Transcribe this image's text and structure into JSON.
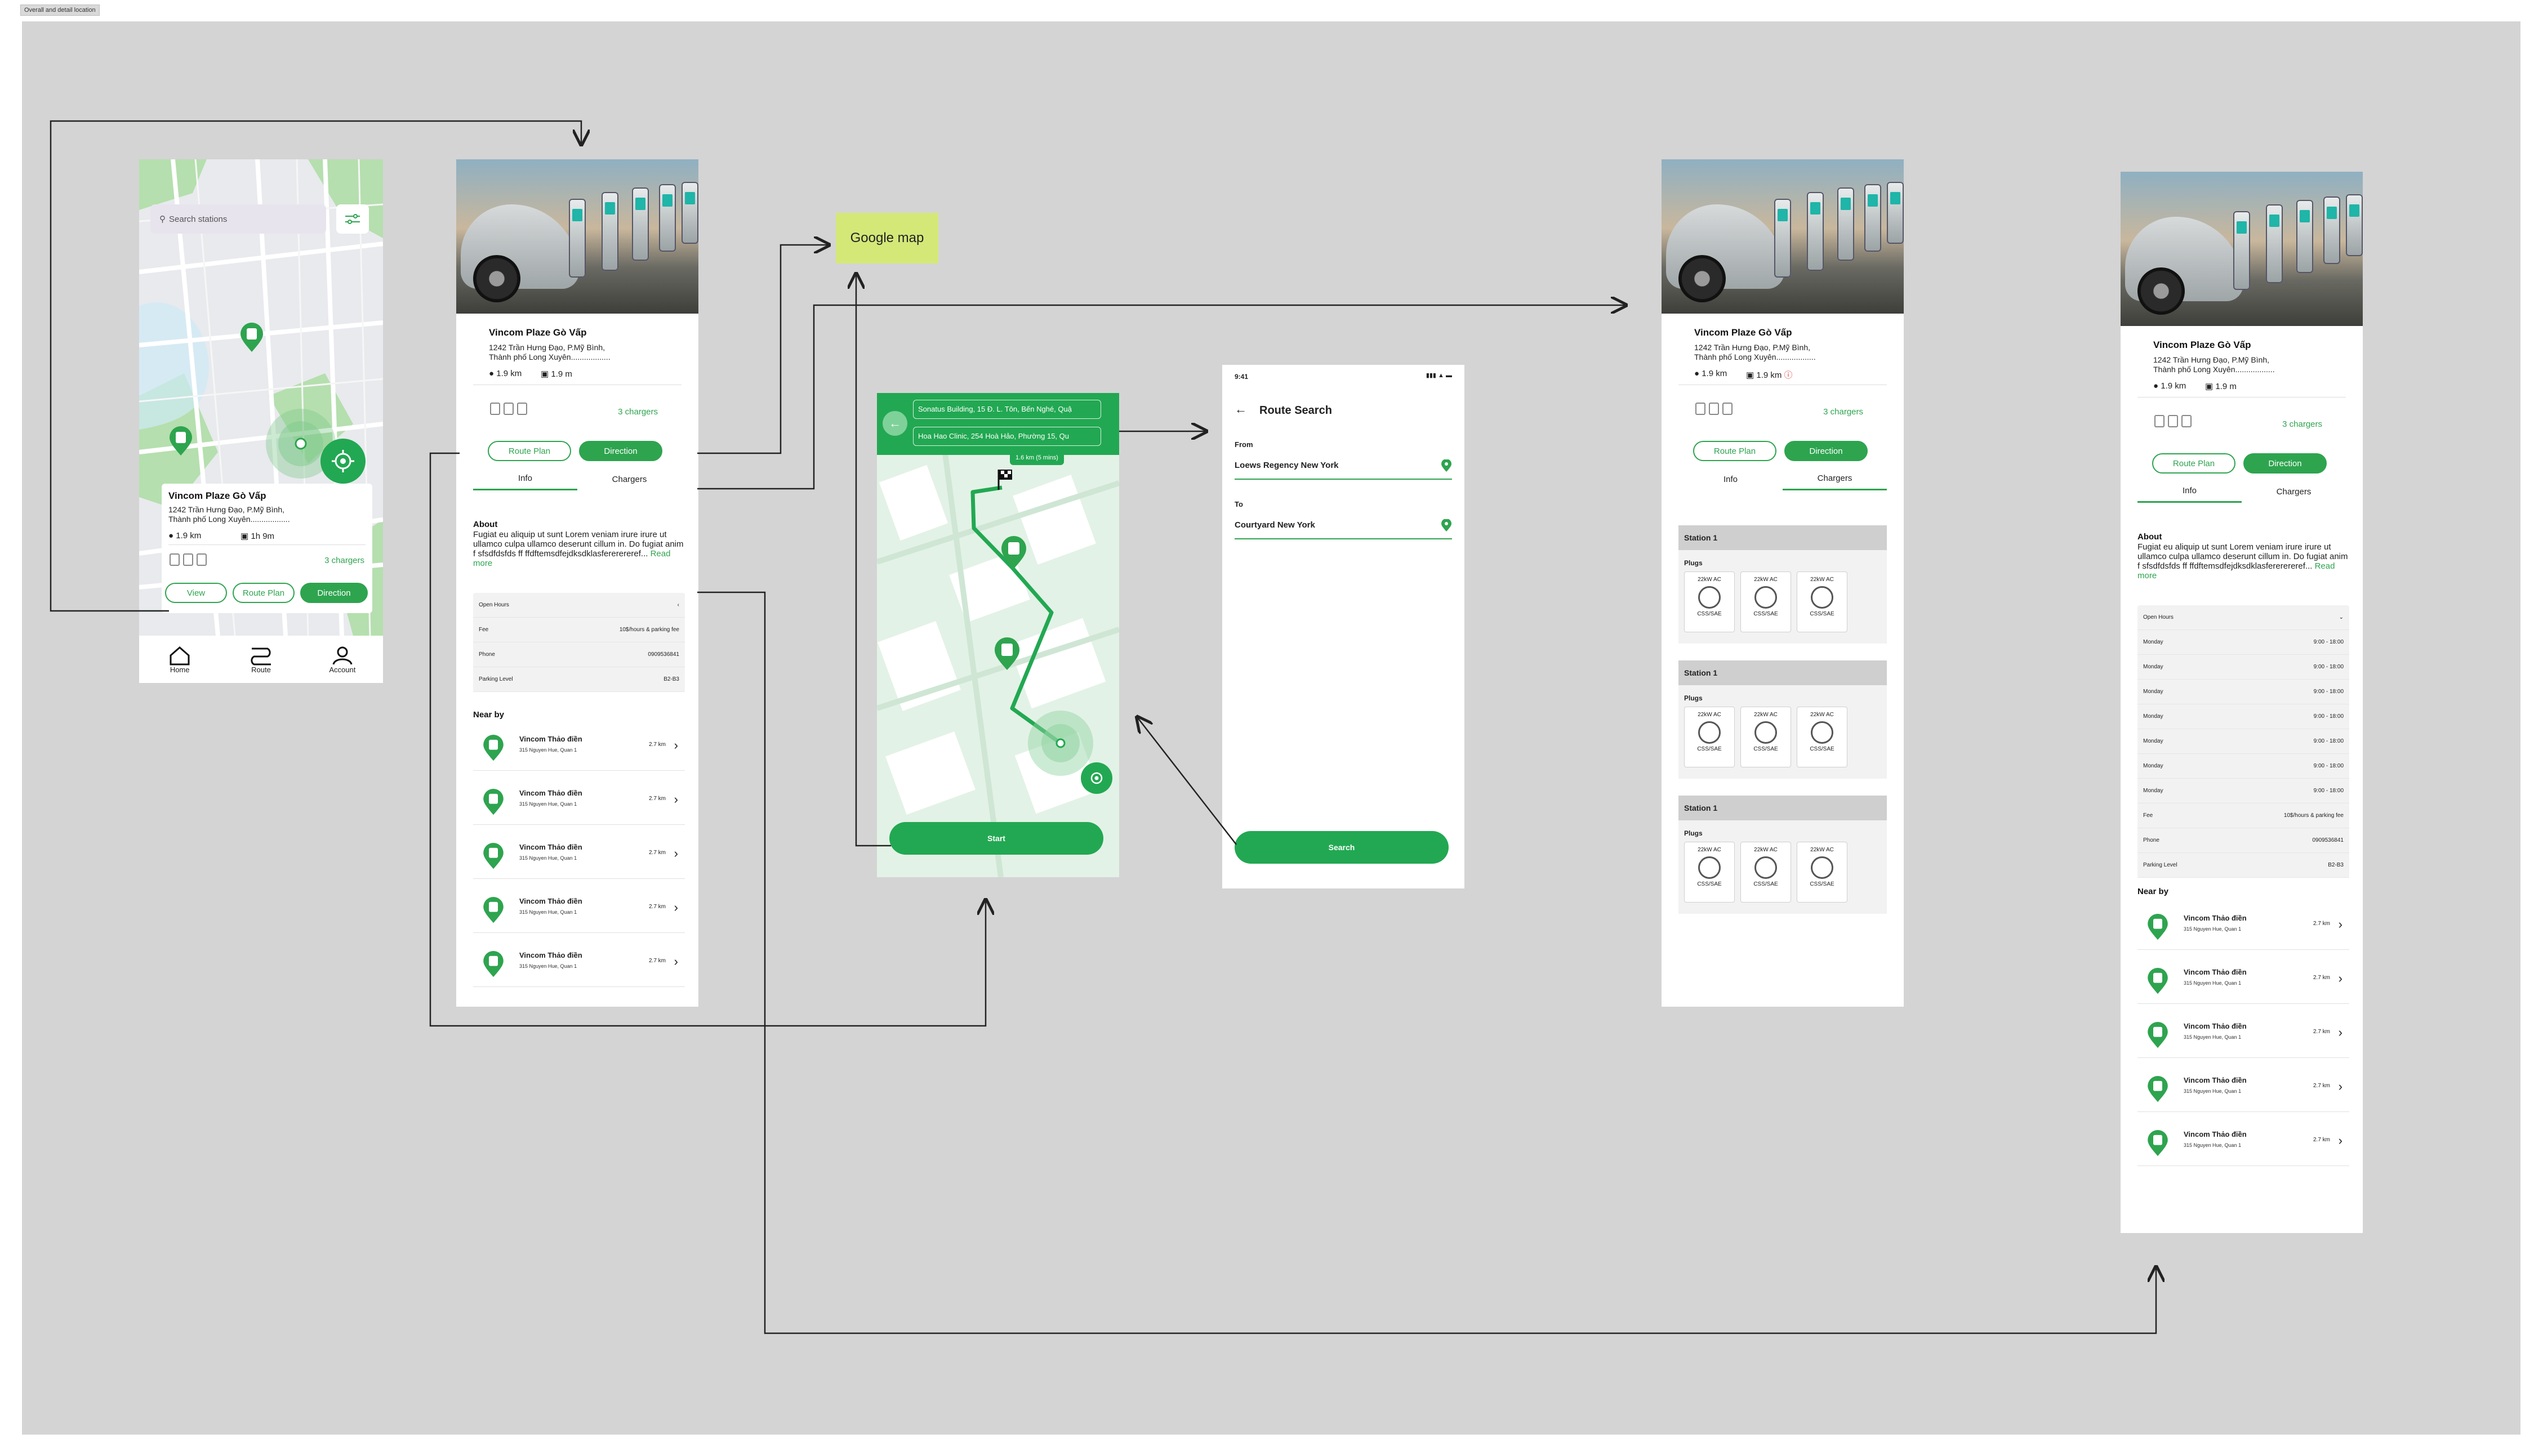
{
  "frame_label": "Overall and detail location",
  "map_screen": {
    "search_placeholder": "Search stations",
    "station_name": "Vincom Plaze Gò Vấp",
    "address_line1": "1242 Trần Hưng Đạo, P.Mỹ Bình,",
    "address_line2": "Thành phố Long Xuyên..................",
    "distance": "1.9 km",
    "duration": "1h 9m",
    "chargers": "3 chargers",
    "btn_view": "View",
    "btn_route": "Route Plan",
    "btn_direction": "Direction",
    "nav": [
      "Home",
      "Route",
      "Account"
    ]
  },
  "detail_info": {
    "station_name": "Vincom Plaze Gò Vấp",
    "address_line1": "1242 Trần Hưng Đạo, P.Mỹ Bình,",
    "address_line2": "Thành phố Long Xuyên..................",
    "distance1": "1.9 km",
    "distance2": "1.9 m",
    "chargers": "3 chargers",
    "btn_route": "Route Plan",
    "btn_direction": "Direction",
    "tab_info": "Info",
    "tab_chargers": "Chargers",
    "about_title": "About",
    "about_text": "Fugiat eu aliquip ut sunt Lorem veniam irure irure ut ullamco culpa ullamco deserunt cillum in. Do fugiat anim f sfsdfdsfds ff ffdftemsdfejdksdklasfererereref...",
    "read_more": "Read more",
    "open_hours": "Open Hours",
    "rows": [
      {
        "label": "Fee",
        "value": "10$/hours & parking fee"
      },
      {
        "label": "Phone",
        "value": "0909536841"
      },
      {
        "label": "Parking Level",
        "value": "B2-B3"
      }
    ],
    "nearby_title": "Near by",
    "nearby": [
      {
        "name": "Vincom Thảo điền",
        "addr": "315 Nguyen Hue, Quan 1",
        "dist": "2.7 km"
      },
      {
        "name": "Vincom Thảo điền",
        "addr": "315 Nguyen Hue, Quan 1",
        "dist": "2.7 km"
      },
      {
        "name": "Vincom Thảo điền",
        "addr": "315 Nguyen Hue, Quan 1",
        "dist": "2.7 km"
      },
      {
        "name": "Vincom Thảo điền",
        "addr": "315 Nguyen Hue, Quan 1",
        "dist": "2.7 km"
      },
      {
        "name": "Vincom Thảo điền",
        "addr": "315 Nguyen Hue, Quan 1",
        "dist": "2.7 km"
      }
    ]
  },
  "google_map_note": "Google map",
  "direction_screen": {
    "from": "Sonatus Building, 15 Đ. L. Tôn, Bến Nghé, Quậ",
    "to": "Hoa Hao Clinic, 254 Hoà Hảo, Phường 15, Qu",
    "eta_badge": "1.6 km (5 mins)",
    "start": "Start"
  },
  "route_search": {
    "time": "9:41",
    "title": "Route Search",
    "from_label": "From",
    "from_value": "Loews Regency New York",
    "to_label": "To",
    "to_value": "Courtyard New York",
    "search": "Search"
  },
  "detail_chargers": {
    "station_name": "Vincom Plaze Gò Vấp",
    "address_line1": "1242 Trần Hưng Đạo, P.Mỹ Bình,",
    "address_line2": "Thành phố Long Xuyên..................",
    "distance1": "1.9 km",
    "distance2": "1.9 km",
    "chargers": "3 chargers",
    "btn_route": "Route Plan",
    "btn_direction": "Direction",
    "tab_info": "Info",
    "tab_chargers": "Chargers",
    "stations": [
      {
        "name": "Station 1",
        "plugs_label": "Plugs",
        "plugs": [
          {
            "power": "22kW AC",
            "type": "CSS/SAE"
          },
          {
            "power": "22kW AC",
            "type": "CSS/SAE"
          },
          {
            "power": "22kW AC",
            "type": "CSS/SAE"
          }
        ]
      },
      {
        "name": "Station 1",
        "plugs_label": "Plugs",
        "plugs": [
          {
            "power": "22kW AC",
            "type": "CSS/SAE"
          },
          {
            "power": "22kW AC",
            "type": "CSS/SAE"
          },
          {
            "power": "22kW AC",
            "type": "CSS/SAE"
          }
        ]
      },
      {
        "name": "Station 1",
        "plugs_label": "Plugs",
        "plugs": [
          {
            "power": "22kW AC",
            "type": "CSS/SAE"
          },
          {
            "power": "22kW AC",
            "type": "CSS/SAE"
          },
          {
            "power": "22kW AC",
            "type": "CSS/SAE"
          }
        ]
      }
    ]
  },
  "detail_hours": {
    "station_name": "Vincom Plaze Gò Vấp",
    "address_line1": "1242 Trần Hưng Đạo, P.Mỹ Bình,",
    "address_line2": "Thành phố Long Xuyên..................",
    "distance1": "1.9 km",
    "distance2": "1.9 m",
    "chargers": "3 chargers",
    "btn_route": "Route Plan",
    "btn_direction": "Direction",
    "tab_info": "Info",
    "tab_chargers": "Chargers",
    "about_title": "About",
    "about_text": "Fugiat eu aliquip ut sunt Lorem veniam irure irure ut ullamco culpa ullamco deserunt cillum in. Do fugiat anim f sfsdfdsfds ff ffdftemsdfejdksdklasfererereref...",
    "read_more": "Read more",
    "open_hours": "Open Hours",
    "hours": [
      {
        "day": "Monday",
        "time": "9:00 - 18:00"
      },
      {
        "day": "Monday",
        "time": "9:00 - 18:00"
      },
      {
        "day": "Monday",
        "time": "9:00 - 18:00"
      },
      {
        "day": "Monday",
        "time": "9:00 - 18:00"
      },
      {
        "day": "Monday",
        "time": "9:00 - 18:00"
      },
      {
        "day": "Monday",
        "time": "9:00 - 18:00"
      },
      {
        "day": "Monday",
        "time": "9:00 - 18:00"
      }
    ],
    "rows": [
      {
        "label": "Fee",
        "value": "10$/hours & parking fee"
      },
      {
        "label": "Phone",
        "value": "0909536841"
      },
      {
        "label": "Parking Level",
        "value": "B2-B3"
      }
    ],
    "nearby_title": "Near by",
    "nearby": [
      {
        "name": "Vincom Thảo điền",
        "addr": "315 Nguyen Hue, Quan 1",
        "dist": "2.7 km"
      },
      {
        "name": "Vincom Thảo điền",
        "addr": "315 Nguyen Hue, Quan 1",
        "dist": "2.7 km"
      },
      {
        "name": "Vincom Thảo điền",
        "addr": "315 Nguyen Hue, Quan 1",
        "dist": "2.7 km"
      },
      {
        "name": "Vincom Thảo điền",
        "addr": "315 Nguyen Hue, Quan 1",
        "dist": "2.7 km"
      },
      {
        "name": "Vincom Thảo điền",
        "addr": "315 Nguyen Hue, Quan 1",
        "dist": "2.7 km"
      }
    ]
  },
  "colors": {
    "accent": "#2ea44f",
    "board": "#d4d4d4",
    "map_green": "#9fd79a",
    "note": "#d4e878"
  }
}
